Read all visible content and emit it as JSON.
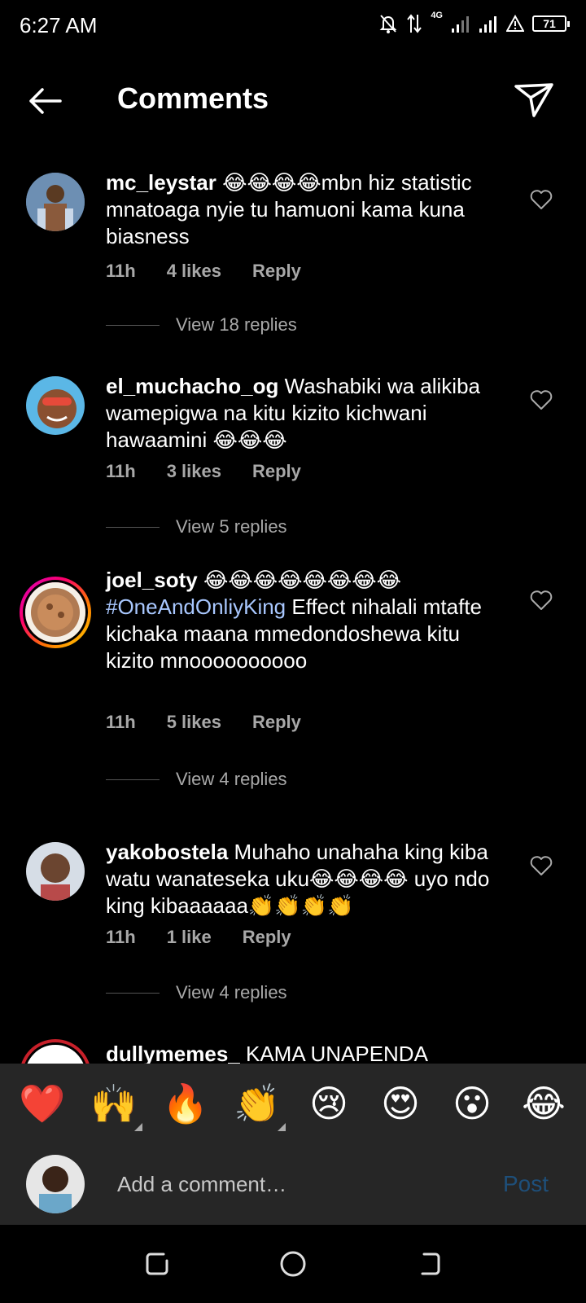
{
  "status_bar": {
    "time": "6:27 AM",
    "network": "4G",
    "battery": "71"
  },
  "header": {
    "title": "Comments"
  },
  "comments": [
    {
      "username": "mc_leystar",
      "text": "😂😂😂😂mbn hiz statistic mnatoaga nyie tu hamuoni kama kuna biasness",
      "time": "11h",
      "likes": "4 likes",
      "reply": "Reply",
      "view_replies": "View 18 replies"
    },
    {
      "username": "el_muchacho_og",
      "text": "Washabiki wa alikiba wamepigwa na kitu kizito kichwani hawaamini 😂😂😂",
      "time": "11h",
      "likes": "3 likes",
      "reply": "Reply",
      "view_replies": "View 5 replies"
    },
    {
      "username": "joel_soty",
      "text_before": "😂😂😂😂😂😂😂😂 ",
      "hashtag": "#OneAndOnliyKing",
      "text_after": " Effect nihalali mtafte kichaka maana mmedondoshewa kitu kizito mnoooooooooo",
      "time": "11h",
      "likes": "5 likes",
      "reply": "Reply",
      "view_replies": "View 4 replies"
    },
    {
      "username": "yakobostela",
      "text": "Muhaho unahaha king kiba watu wanateseka uku😂😂😂😂 uyo ndo king kibaaaaaa👏👏👏👏",
      "time": "11h",
      "likes": "1 like",
      "reply": "Reply",
      "view_replies": "View 4 replies"
    },
    {
      "username": "dullymemes_",
      "text": "KAMA UNAPENDA"
    }
  ],
  "reactions": [
    "❤️",
    "🙌",
    "🔥",
    "👏",
    "😢",
    "😍",
    "😮",
    "😂"
  ],
  "input": {
    "placeholder": "Add a comment…",
    "post_label": "Post"
  },
  "colors": {
    "background": "#000000",
    "secondary_text": "#a8a8a8",
    "hashtag": "#a9c8ff",
    "post_disabled": "#1e4f7a"
  }
}
